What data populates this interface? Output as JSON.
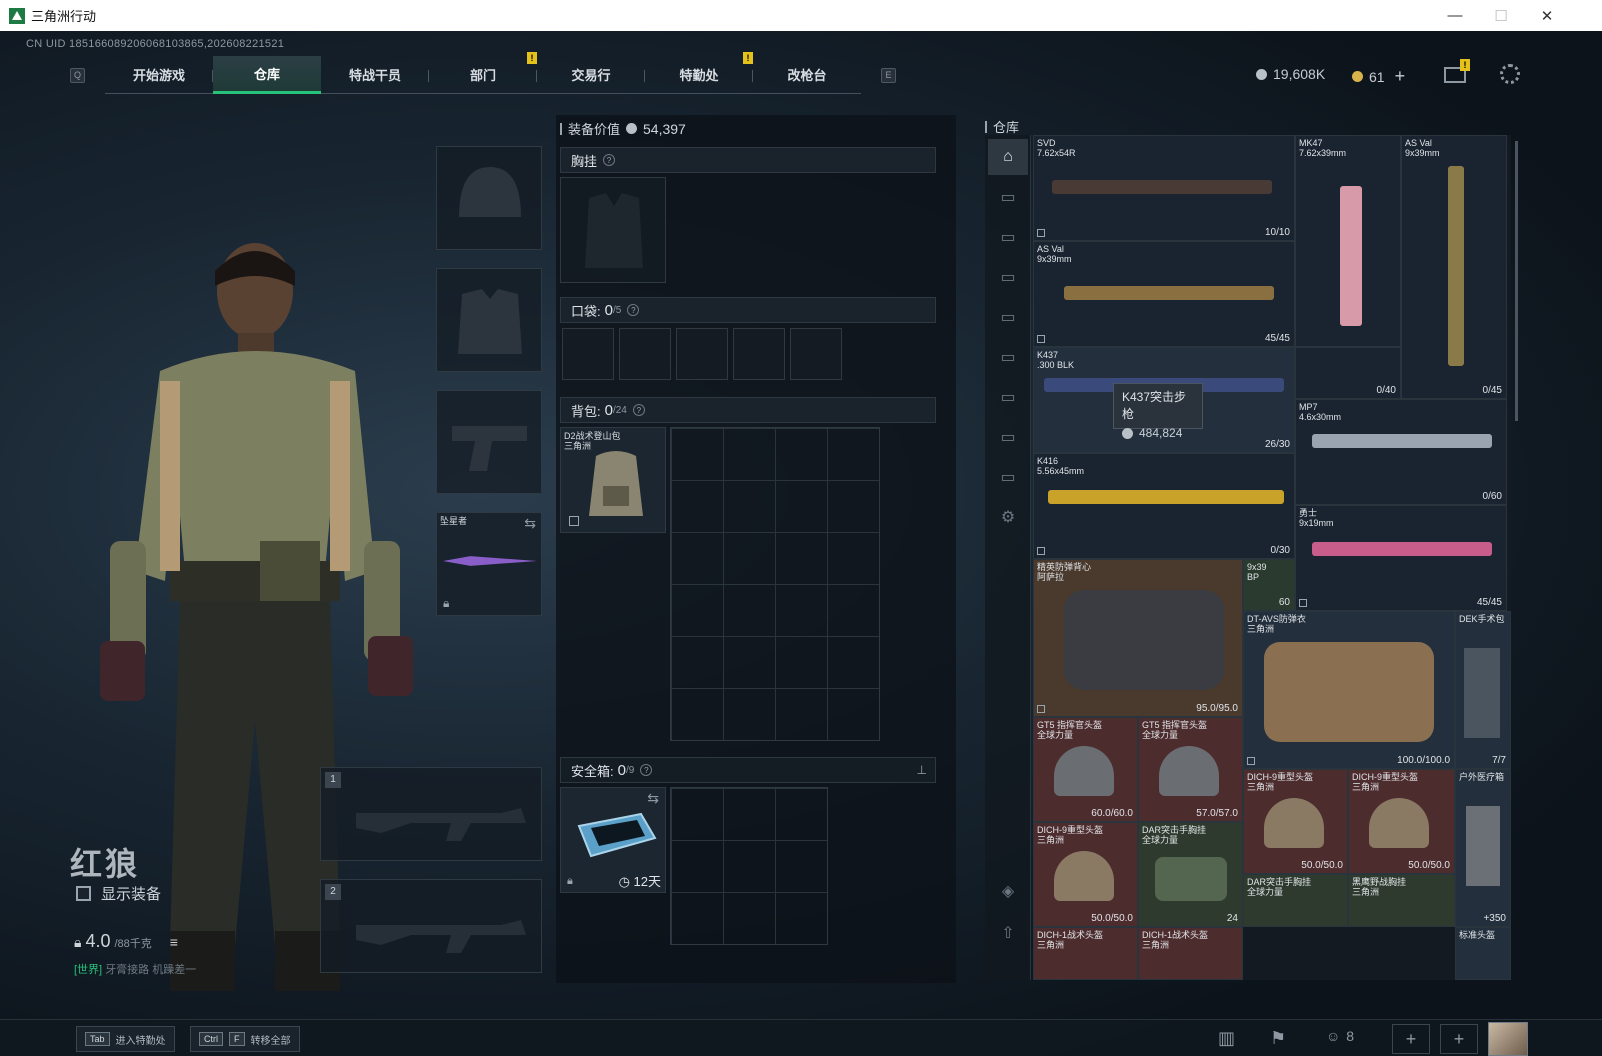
{
  "window": {
    "title": "三角洲行动",
    "controls": [
      "—",
      "☐",
      "✕"
    ]
  },
  "header": {
    "uid": "CN UID 185166089206068103865,202608221521",
    "key_left": "Q",
    "key_right": "E",
    "tabs": [
      {
        "label": "开始游戏",
        "active": false
      },
      {
        "label": "仓库",
        "active": true
      },
      {
        "label": "特战干员",
        "active": false
      },
      {
        "label": "部门",
        "active": false,
        "badge": "!"
      },
      {
        "label": "交易行",
        "active": false
      },
      {
        "label": "特勤处",
        "active": false,
        "badge": "!"
      },
      {
        "label": "改枪台",
        "active": false
      }
    ],
    "currency": "19,608K",
    "coupons": "61",
    "plus": "+",
    "mail_badge": "!"
  },
  "character": {
    "name": "红狼",
    "show_gear": "显示装备",
    "weight": "4.0",
    "weight_max": "/88千克",
    "chat_channel": "[世界]",
    "chat_text": "牙膏接路 机躁差一",
    "melee_name": "坠星者",
    "slot1": "1",
    "slot2": "2"
  },
  "loadout": {
    "value_label": "装备价值",
    "value": "54,397",
    "chest_label": "胸挂",
    "pocket_label": "口袋:",
    "pocket_count": "0",
    "pocket_max": "/5",
    "backpack_label": "背包:",
    "backpack_count": "0",
    "backpack_max": "/24",
    "backpack_item": "D2战术登山包\n三角洲",
    "safebox_label": "安全箱:",
    "safebox_count": "0",
    "safebox_max": "/9",
    "safebox_timer": "12天"
  },
  "stash": {
    "title": "仓库",
    "tooltip_name": "K437突击步枪",
    "tooltip_price": "484,824",
    "items": [
      {
        "name": "SVD",
        "sub": "7.62x54R",
        "count": "10/10"
      },
      {
        "name": "MK47",
        "sub": "7.62x39mm",
        "count": ""
      },
      {
        "name": "AS Val",
        "sub": "9x39mm",
        "count": "0/45"
      },
      {
        "name": "AS Val",
        "sub": "9x39mm",
        "count": "45/45"
      },
      {
        "name": "",
        "sub": "",
        "count": "0/40"
      },
      {
        "name": "K437",
        "sub": ".300 BLK",
        "count": "26/30"
      },
      {
        "name": "MP7",
        "sub": "4.6x30mm",
        "count": "0/60"
      },
      {
        "name": "K416",
        "sub": "5.56x45mm",
        "count": "0/30"
      },
      {
        "name": "勇士",
        "sub": "9x19mm",
        "count": "45/45"
      },
      {
        "name": "精英防弹背心",
        "sub": "阿萨拉",
        "count": "95.0/95.0"
      },
      {
        "name": "9x39",
        "sub": "BP",
        "count": "60"
      },
      {
        "name": "DT-AVS防弹衣",
        "sub": "三角洲",
        "count": "100.0/100.0"
      },
      {
        "name": "DEK手术包",
        "sub": "",
        "count": "7/7"
      },
      {
        "name": "GT5 指挥官头盔",
        "sub": "全球力量",
        "count": "60.0/60.0"
      },
      {
        "name": "GT5 指挥官头盔",
        "sub": "全球力量",
        "count": "57.0/57.0"
      },
      {
        "name": "DICH-9重型头盔",
        "sub": "三角洲",
        "count": "50.0/50.0"
      },
      {
        "name": "DICH-9重型头盔",
        "sub": "三角洲",
        "count": "50.0/50.0"
      },
      {
        "name": "户外医疗箱",
        "sub": "",
        "count": "+350"
      },
      {
        "name": "DICH-9重型头盔",
        "sub": "三角洲",
        "count": "50.0/50.0"
      },
      {
        "name": "DAR突击手胸挂",
        "sub": "全球力量",
        "count": "24"
      },
      {
        "name": "DAR突击手胸挂",
        "sub": "全球力量",
        "count": ""
      },
      {
        "name": "黑鹰野战胸挂",
        "sub": "三角洲",
        "count": ""
      },
      {
        "name": "DICH-1战术头盔",
        "sub": "三角洲",
        "count": ""
      },
      {
        "name": "DICH-1战术头盔",
        "sub": "三角洲",
        "count": ""
      },
      {
        "name": "标准头盔",
        "sub": "",
        "count": ""
      }
    ]
  },
  "bottom": {
    "btn1_key": "Tab",
    "btn1_label": "进入特勤处",
    "btn2_key1": "Ctrl",
    "btn2_key2": "F",
    "btn2_label": "转移全部",
    "friends_count": "8"
  },
  "colors": {
    "accent": "#27c27a",
    "badge": "#e5c21a",
    "weapon_cell": "#1a2430",
    "armor_cell": "#4a3a2e",
    "helmet_cell": "#4d2c2e"
  }
}
